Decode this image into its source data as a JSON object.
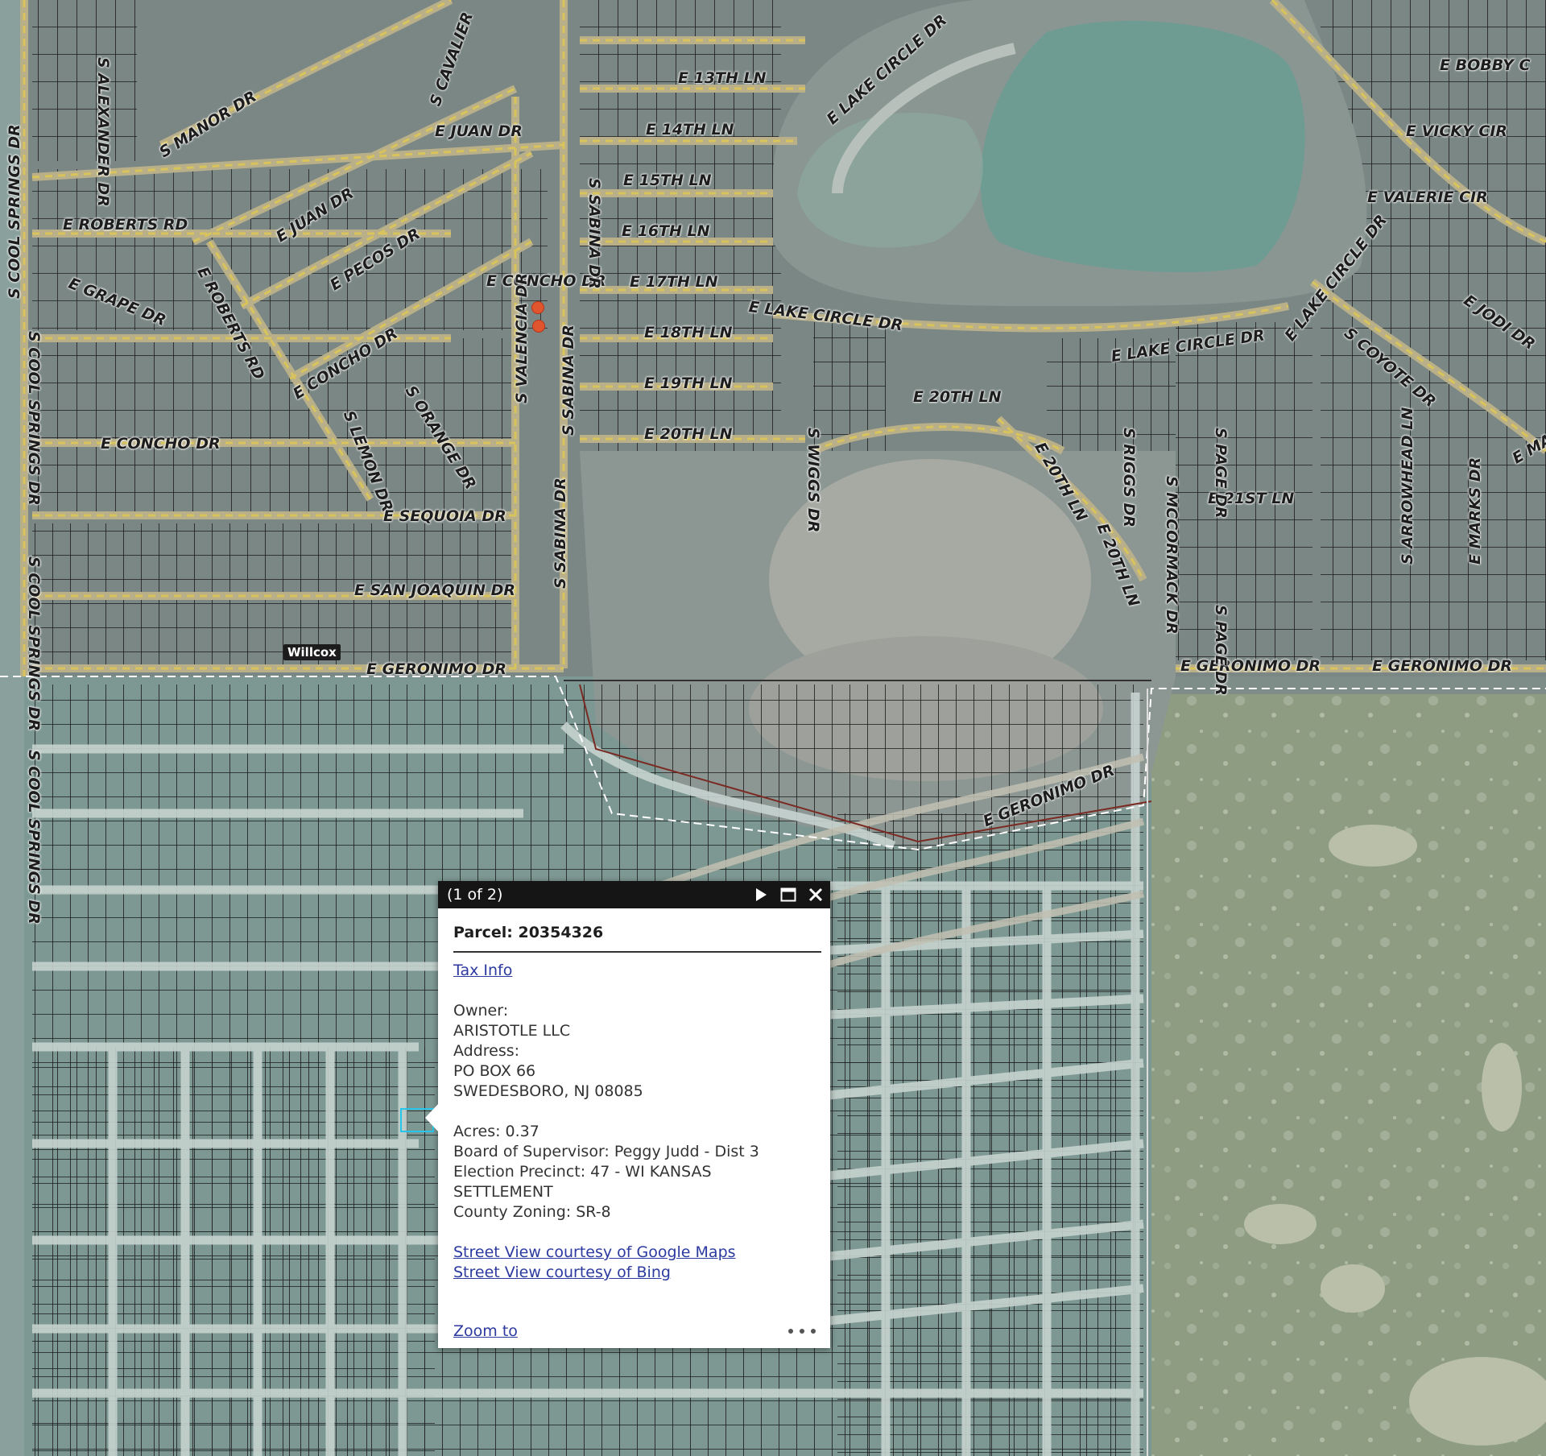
{
  "colors": {
    "map_base": "#7f8d88",
    "parcel_lines": "#1a1a1a",
    "road_fill": "#d8c45a",
    "open_land": "#8f9d82",
    "water": "#6e9b92",
    "selection": "#27c5e9",
    "marker": "#e0552d",
    "popup_header": "#151515",
    "link": "#2c3aa0"
  },
  "map": {
    "place_label": "Willcox",
    "street_labels": [
      "S ALEXANDER DR",
      "S MANOR DR",
      "S CAVALIER",
      "E JUAN DR",
      "E JUAN DR",
      "E ROBERTS RD",
      "E ROBERTS RD",
      "E GRAPE DR",
      "E PECOS DR",
      "E CONCHO DR",
      "E CONCHO DR",
      "E CONCHO DR",
      "S LEMON DR",
      "S ORANGE DR",
      "S VALENCIA DR",
      "S SABINA DR",
      "S SABINA DR",
      "S SABINA DR",
      "E SEQUOIA DR",
      "E SAN JOAQUIN DR",
      "E GERONIMO DR",
      "E GERONIMO DR",
      "E GERONIMO DR",
      "E GERONIMO DR",
      "S COOL SPRINGS DR",
      "S COOL SPRINGS DR",
      "S COOL SPRINGS DR",
      "S COOL SPRINGS DR",
      "E 13TH LN",
      "E 14TH LN",
      "E 15TH LN",
      "E 16TH LN",
      "E 17TH LN",
      "E 18TH LN",
      "E 19TH LN",
      "E 20TH LN",
      "E 20TH LN",
      "E 20TH LN",
      "E 20TH LN",
      "E 21ST LN",
      "E LAKE CIRCLE DR",
      "E LAKE CIRCLE DR",
      "E LAKE CIRCLE DR",
      "E LAKE CIRCLE DR",
      "S WIGGS DR",
      "S RIGGS DR",
      "S MCCORMACK DR",
      "S PAGE DR",
      "S PAGE DR",
      "S ARROWHEAD LN",
      "E MARKS DR",
      "E BOBBY C",
      "E VICKY CIR",
      "E VALERIE CIR",
      "E JODI DR",
      "S COYOTE DR",
      "E MA",
      "E LAKE CIRCLE DR",
      "S ABINA DR",
      "SE DR",
      "S"
    ]
  },
  "popup": {
    "counter": "(1 of 2)",
    "next_icon": "play-icon",
    "maximize_icon": "maximize-icon",
    "close_icon": "close-icon",
    "title": "Parcel: 20354326",
    "tax_link": "Tax Info",
    "owner_label": "Owner:",
    "owner_value": "ARISTOTLE LLC",
    "address_label": "Address:",
    "address_line1": "PO BOX 66",
    "address_line2": "SWEDESBORO, NJ 08085",
    "acres": "Acres: 0.37",
    "supervisor": "Board of Supervisor: Peggy Judd - Dist 3",
    "precinct_line1": "Election Precinct: 47 - WI KANSAS",
    "precinct_line2": "SETTLEMENT",
    "zoning": "County Zoning: SR-8",
    "street_view_google": "Street View courtesy of Google Maps",
    "street_view_bing": "Street View courtesy of Bing",
    "zoom_to": "Zoom to",
    "more_icon": "more-options-icon"
  }
}
